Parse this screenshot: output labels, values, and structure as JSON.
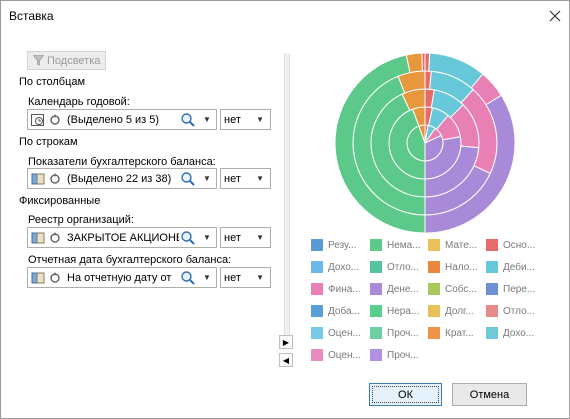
{
  "window": {
    "title": "Вставка"
  },
  "left": {
    "filter_button": "Подсветка",
    "group_columns": "По столбцам",
    "group_rows": "По строкам",
    "group_fixed": "Фиксированные",
    "dims": [
      {
        "label": "Календарь годовой:",
        "value": "(Выделено 5 из 5)",
        "mode": "нет"
      },
      {
        "label": "Показатели бухгалтерского баланса:",
        "value": "(Выделено 22 из 38)",
        "mode": "нет"
      },
      {
        "label": "Реестр организаций:",
        "value": "ЗАКРЫТОЕ АКЦИОНЕР",
        "mode": "нет"
      },
      {
        "label": "Отчетная дата бухгалтерского баланса:",
        "value": "На отчетную дату от",
        "mode": "нет"
      }
    ]
  },
  "legend": [
    {
      "label": "Резу...",
      "color": "#5b9bd5"
    },
    {
      "label": "Нема...",
      "color": "#5cc98a"
    },
    {
      "label": "Мате...",
      "color": "#e8c15b"
    },
    {
      "label": "Осно...",
      "color": "#e86b6b"
    },
    {
      "label": "Дохо...",
      "color": "#6cb9ea"
    },
    {
      "label": "Отло...",
      "color": "#56c4a0"
    },
    {
      "label": "Нало...",
      "color": "#e8873d"
    },
    {
      "label": "Деби...",
      "color": "#66c8d8"
    },
    {
      "label": "Фина...",
      "color": "#e87fb5"
    },
    {
      "label": "Дене...",
      "color": "#a88ad8"
    },
    {
      "label": "Собс...",
      "color": "#a8c85c"
    },
    {
      "label": "Пере...",
      "color": "#6c8fd8"
    },
    {
      "label": "Доба...",
      "color": "#5aa0d8"
    },
    {
      "label": "Нера...",
      "color": "#58cf8e"
    },
    {
      "label": "Долг...",
      "color": "#e8c15b"
    },
    {
      "label": "Отло...",
      "color": "#e88a8a"
    },
    {
      "label": "Оцен...",
      "color": "#78c8ea"
    },
    {
      "label": "Проч...",
      "color": "#6fcfa4"
    },
    {
      "label": "Крат...",
      "color": "#ee9448"
    },
    {
      "label": "Дохо...",
      "color": "#6ecad6"
    },
    {
      "label": "Оцен...",
      "color": "#e88bc0"
    },
    {
      "label": "Проч...",
      "color": "#b292e0"
    }
  ],
  "buttons": {
    "ok": "ОК",
    "cancel": "Отмена"
  }
}
